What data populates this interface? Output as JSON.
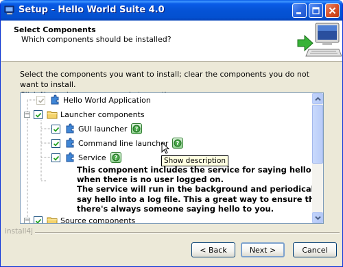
{
  "window": {
    "title": "Setup - Hello World Suite 4.0"
  },
  "header": {
    "title": "Select Components",
    "subtitle": "Which components should be installed?"
  },
  "instructions": {
    "line1": "Select the components you want to install; clear the components you do not want to install.",
    "line2": "Click Next when you are ready to continue."
  },
  "tree": {
    "items": [
      {
        "label": "Hello World Application",
        "checked": true,
        "disabled": true,
        "icon": "puzzle-icon"
      },
      {
        "label": "Launcher components",
        "checked": true,
        "expanded": true,
        "icon": "folder-icon"
      },
      {
        "label": "GUI launcher",
        "checked": true,
        "icon": "puzzle-icon",
        "info": true
      },
      {
        "label": "Command line launcher",
        "checked": true,
        "icon": "puzzle-icon",
        "info": true
      },
      {
        "label": "Service",
        "checked": true,
        "icon": "puzzle-icon",
        "info": true
      },
      {
        "label": "Source components",
        "checked": true,
        "expanded": true,
        "icon": "folder-icon"
      }
    ],
    "description": [
      "This component includes the service for saying hello even",
      "when there is no user logged on.",
      "The service will run in the background and periodically",
      "say hello into a log file. This a great way to ensure that",
      "there's always someone saying hello to you."
    ]
  },
  "tooltip": "Show description",
  "brand": "install4j",
  "buttons": {
    "back": "< Back",
    "next": "Next >",
    "cancel": "Cancel"
  },
  "colors": {
    "titlebar": "#0553d6",
    "dialog_bg": "#ece9d8",
    "info_green": "#4aa84a"
  }
}
